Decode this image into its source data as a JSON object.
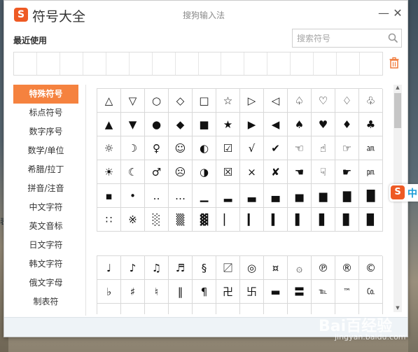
{
  "window": {
    "logo": "S",
    "title": "符号大全",
    "subtitle": "搜狗输入法",
    "minimize": "—",
    "close": "✕"
  },
  "recent": {
    "label": "最近使用",
    "slots": 16
  },
  "search": {
    "placeholder": "搜索符号"
  },
  "colors": {
    "accent": "#f5823f",
    "brand": "#ee5a24"
  },
  "sidebar": {
    "items": [
      {
        "label": "特殊符号",
        "active": true
      },
      {
        "label": "标点符号",
        "active": false
      },
      {
        "label": "数字序号",
        "active": false
      },
      {
        "label": "数学/单位",
        "active": false
      },
      {
        "label": "希腊/拉丁",
        "active": false
      },
      {
        "label": "拼音/注音",
        "active": false
      },
      {
        "label": "中文字符",
        "active": false
      },
      {
        "label": "英文音标",
        "active": false
      },
      {
        "label": "日文字符",
        "active": false
      },
      {
        "label": "韩文字符",
        "active": false
      },
      {
        "label": "俄文字母",
        "active": false
      },
      {
        "label": "制表符",
        "active": false
      }
    ]
  },
  "symbols_group1": [
    "△",
    "▽",
    "○",
    "◇",
    "□",
    "☆",
    "▷",
    "◁",
    "♤",
    "♡",
    "♢",
    "♧",
    "▲",
    "▼",
    "●",
    "◆",
    "■",
    "★",
    "▶",
    "◀",
    "♠",
    "♥",
    "♦",
    "♣",
    "☼",
    "☽",
    "♀",
    "☺",
    "◐",
    "☑",
    "√",
    "✔",
    "☜",
    "☝",
    "☞",
    "㏂",
    "☀",
    "☾",
    "♂",
    "☹",
    "◑",
    "☒",
    "×",
    "✘",
    "☚",
    "☟",
    "☛",
    "㏘",
    "▪",
    "•",
    "‥",
    "…",
    "▁",
    "▂",
    "▃",
    "▄",
    "▅",
    "▆",
    "▇",
    "█",
    "∷",
    "※",
    "░",
    "▒",
    "▓",
    "▏",
    "▎",
    "▍",
    "▌",
    "▋",
    "▊",
    "▉"
  ],
  "symbols_group2": [
    "♩",
    "♪",
    "♫",
    "♬",
    "§",
    "〼",
    "◎",
    "¤",
    "۞",
    "℗",
    "®",
    "©",
    "♭",
    "♯",
    "♮",
    "‖",
    "¶",
    "卍",
    "卐",
    "▬",
    "〓",
    "℡",
    "™",
    "㏇",
    "",
    "",
    "",
    "",
    "",
    "",
    "",
    "",
    "",
    "",
    "",
    ""
  ],
  "watermark": {
    "text": "Bai百经验",
    "sub": "jingyan.baidu.com"
  },
  "float_badge": {
    "logo": "S",
    "text": "中"
  },
  "desktop_char": "表"
}
